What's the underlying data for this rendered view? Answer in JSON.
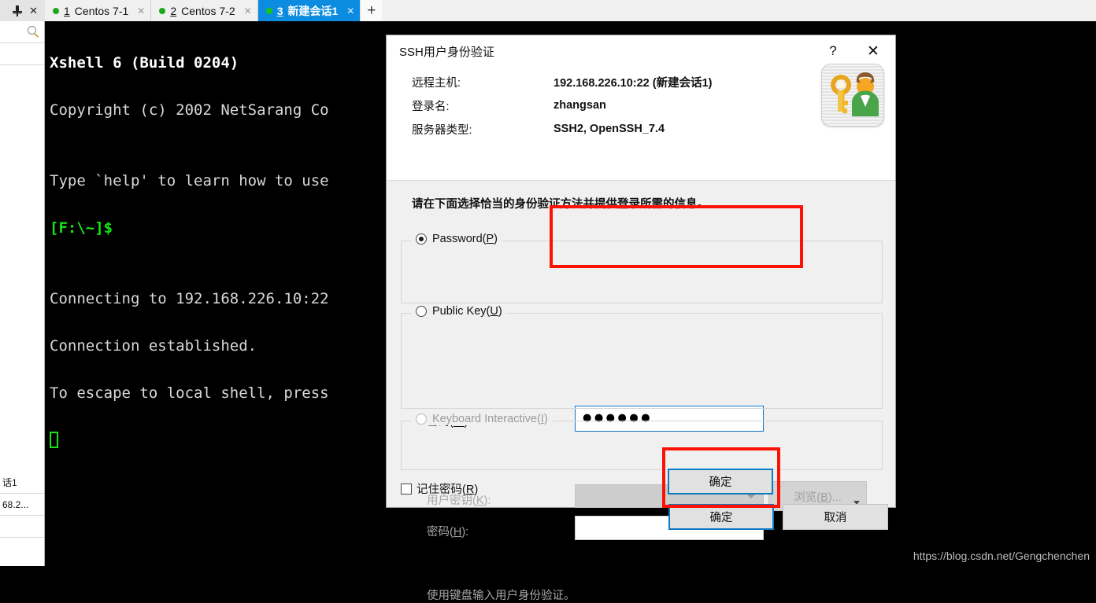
{
  "window": {
    "sidepanel": {
      "pin_icon": "pin-icon",
      "close_icon": "close-icon",
      "search_icon": "search-icon",
      "bottom_items": [
        "话1",
        "68.2..."
      ]
    },
    "tabs": [
      {
        "num": "1",
        "label": "Centos 7-1",
        "status": "connected",
        "active": false
      },
      {
        "num": "2",
        "label": "Centos 7-2",
        "status": "connected",
        "active": false
      },
      {
        "num": "3",
        "label": "新建会话1",
        "status": "connected",
        "active": true
      }
    ],
    "new_tab_label": "+",
    "close_glyph": "✕"
  },
  "terminal": {
    "lines": [
      {
        "text": "Xshell 6 (Build 0204)",
        "style": "bold"
      },
      {
        "text": "Copyright (c) 2002 NetSarang Co",
        "style": "normal"
      },
      {
        "text": "",
        "style": "normal"
      },
      {
        "text": "Type `help' to learn how to use",
        "style": "normal"
      },
      {
        "text": "[F:\\~]$",
        "style": "green"
      },
      {
        "text": "",
        "style": "normal"
      },
      {
        "text": "Connecting to 192.168.226.10:22",
        "style": "normal"
      },
      {
        "text": "Connection established.",
        "style": "normal"
      },
      {
        "text": "To escape to local shell, press",
        "style": "normal"
      }
    ],
    "watermark": "https://blog.csdn.net/Gengchenchen"
  },
  "dialog": {
    "title": "SSH用户身份验证",
    "help_label": "?",
    "close_label": "✕",
    "icon_name": "key-user-icon",
    "info": [
      {
        "label": "远程主机:",
        "value": "192.168.226.10:22 (新建会话1)"
      },
      {
        "label": "登录名:",
        "value": "zhangsan"
      },
      {
        "label": "服务器类型:",
        "value": "SSH2, OpenSSH_7.4"
      }
    ],
    "prompt": "请在下面选择恰当的身份验证方法并提供登录所需的信息。",
    "password_group": {
      "legend": "Password(",
      "legend_key": "P",
      "legend_tail": ")",
      "selected": true,
      "field_label": "密码(",
      "field_key": "W",
      "field_label_tail": "):",
      "value_dots": "●●●●●●"
    },
    "publickey_group": {
      "legend": "Public Key(",
      "legend_key": "U",
      "legend_tail": ")",
      "selected": false,
      "userkey_label": "用户密钥(",
      "userkey_key": "K",
      "userkey_tail": "):",
      "userkey_value": "",
      "browse_label": "浏览(",
      "browse_key": "B",
      "browse_tail": ")...",
      "password_label": "密码(",
      "password_key": "H",
      "password_tail": "):",
      "password_value": ""
    },
    "keyboard_group": {
      "legend": "Keyboard Interactive(",
      "legend_key": "I",
      "legend_tail": ")",
      "selected": false,
      "description": "使用键盘输入用户身份验证。"
    },
    "remember": {
      "label": "记住密码(",
      "key": "R",
      "tail": ")",
      "checked": false
    },
    "ok_label": "确定",
    "cancel_label": "取消",
    "highlight_color": "#fb1205",
    "accent_color": "#0d7ac4"
  }
}
